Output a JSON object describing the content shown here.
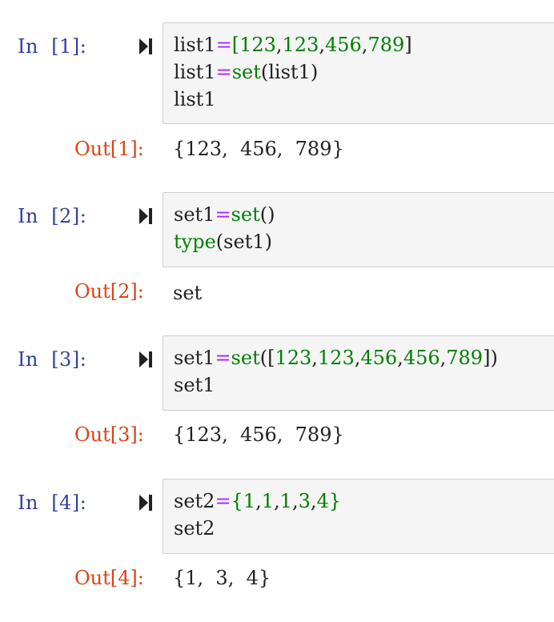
{
  "cells": [
    {
      "in_prompt": "In  [1]:",
      "code": [
        [
          {
            "t": "list1",
            "c": "p"
          },
          {
            "t": "=",
            "c": "op"
          },
          {
            "t": "[",
            "c": "num"
          },
          {
            "t": "123",
            "c": "num"
          },
          {
            "t": ",",
            "c": "p"
          },
          {
            "t": "123",
            "c": "num"
          },
          {
            "t": ",",
            "c": "p"
          },
          {
            "t": "456",
            "c": "num"
          },
          {
            "t": ",",
            "c": "p"
          },
          {
            "t": "789",
            "c": "num"
          },
          {
            "t": "]",
            "c": "p"
          }
        ],
        [
          {
            "t": "list1",
            "c": "p"
          },
          {
            "t": "=",
            "c": "op"
          },
          {
            "t": "set",
            "c": "kw"
          },
          {
            "t": "(list1)",
            "c": "p"
          }
        ],
        [
          {
            "t": "list1",
            "c": "p"
          }
        ]
      ],
      "out_prompt": "Out[1]:",
      "output": "{123,  456,  789}"
    },
    {
      "in_prompt": "In  [2]:",
      "code": [
        [
          {
            "t": "set1",
            "c": "p"
          },
          {
            "t": "=",
            "c": "op"
          },
          {
            "t": "set",
            "c": "kw"
          },
          {
            "t": "()",
            "c": "p"
          }
        ],
        [
          {
            "t": "type",
            "c": "kw"
          },
          {
            "t": "(set1)",
            "c": "p"
          }
        ]
      ],
      "out_prompt": "Out[2]:",
      "output": "set"
    },
    {
      "in_prompt": "In  [3]:",
      "code": [
        [
          {
            "t": "set1",
            "c": "p"
          },
          {
            "t": "=",
            "c": "op"
          },
          {
            "t": "set",
            "c": "kw"
          },
          {
            "t": "([",
            "c": "p"
          },
          {
            "t": "123",
            "c": "num"
          },
          {
            "t": ",",
            "c": "p"
          },
          {
            "t": "123",
            "c": "num"
          },
          {
            "t": ",",
            "c": "p"
          },
          {
            "t": "456",
            "c": "num"
          },
          {
            "t": ",",
            "c": "p"
          },
          {
            "t": "456",
            "c": "num"
          },
          {
            "t": ",",
            "c": "p"
          },
          {
            "t": "789",
            "c": "num"
          },
          {
            "t": "])",
            "c": "p"
          }
        ],
        [
          {
            "t": "set1",
            "c": "p"
          }
        ]
      ],
      "out_prompt": "Out[3]:",
      "output": "{123,  456,  789}"
    },
    {
      "in_prompt": "In  [4]:",
      "code": [
        [
          {
            "t": "set2",
            "c": "p"
          },
          {
            "t": "=",
            "c": "op"
          },
          {
            "t": "{",
            "c": "num"
          },
          {
            "t": "1",
            "c": "num"
          },
          {
            "t": ",",
            "c": "p"
          },
          {
            "t": "1",
            "c": "num"
          },
          {
            "t": ",",
            "c": "p"
          },
          {
            "t": "1",
            "c": "num"
          },
          {
            "t": ",",
            "c": "p"
          },
          {
            "t": "3",
            "c": "num"
          },
          {
            "t": ",",
            "c": "p"
          },
          {
            "t": "4",
            "c": "num"
          },
          {
            "t": "}",
            "c": "num"
          }
        ],
        [
          {
            "t": "set2",
            "c": "p"
          }
        ]
      ],
      "out_prompt": "Out[4]:",
      "output": "{1,  3,  4}"
    }
  ],
  "icons": {
    "run": "run-cell-icon"
  },
  "colors": {
    "in_prompt": "#303f9f",
    "out_prompt": "#d84315",
    "keyword": "#008000",
    "operator": "#aa22ff",
    "code_bg": "#f5f5f5"
  }
}
